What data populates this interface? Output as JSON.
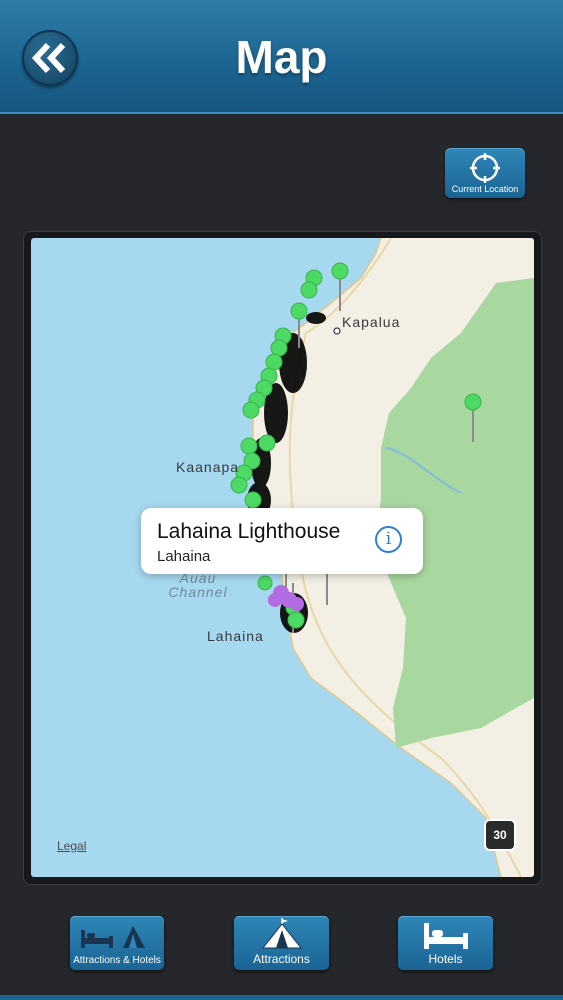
{
  "header": {
    "title": "Map",
    "back_icon": "double-chevron-left-icon"
  },
  "current_location": {
    "label": "Current Location",
    "icon": "crosshair-icon"
  },
  "map": {
    "places": {
      "kapalua": "Kapalua",
      "kaanapali": "Kaanapa",
      "lahaina": "Lahaina",
      "channel_line1": "Auau",
      "channel_line2": "Channel"
    },
    "legal": "Legal",
    "route_shield": "30",
    "callout": {
      "title": "Lahaina Lighthouse",
      "subtitle": "Lahaina",
      "info_icon": "info-icon"
    },
    "colors": {
      "water": "#a6d8ef",
      "land": "#f3efe4",
      "park": "#a8d79f",
      "pin_green": "#4cd964",
      "pin_purple": "#b36ae2"
    }
  },
  "tabs": {
    "attractions_hotels": "Attractions & Hotels",
    "attractions": "Attractions",
    "hotels": "Hotels"
  }
}
